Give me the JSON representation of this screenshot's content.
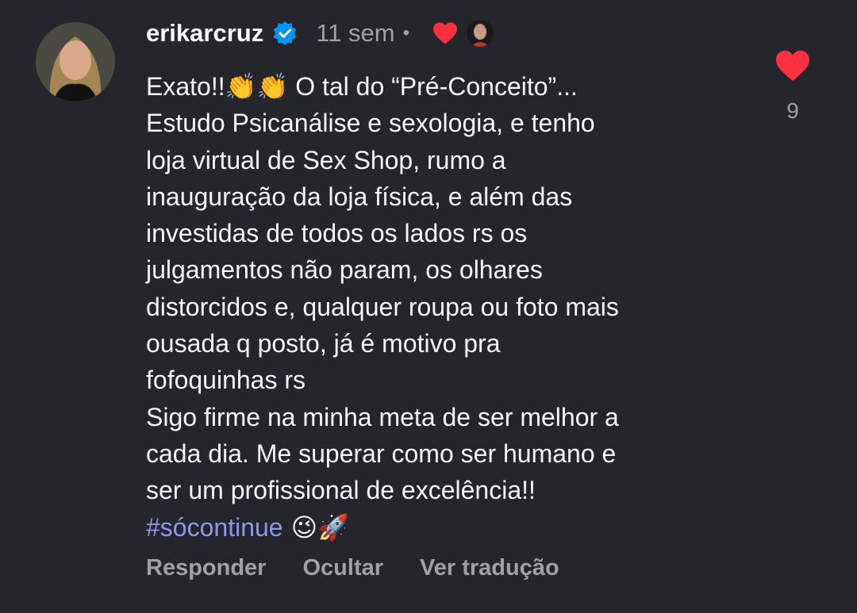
{
  "comment": {
    "username": "erikarcruz",
    "time": "11 sem",
    "dot": "•",
    "lines": [
      "Exato!!👏👏 O tal do “Pré-Conceito”...",
      "Estudo Psicanálise e sexologia, e tenho",
      "loja virtual de Sex Shop, rumo a",
      "inauguração da loja física, e além das",
      "investidas de todos os lados rs os",
      "julgamentos não param, os olhares",
      "distorcidos e, qualquer roupa ou foto mais",
      "ousada q posto, já é motivo pra",
      "fofoquinhas rs",
      "Sigo firme na minha meta de ser melhor a",
      "cada dia. Me superar como ser humano e",
      "ser um profissional de excelência!!"
    ],
    "hashtag": "#sócontinue",
    "trailing_emoji": " 😉🚀",
    "like_count": "9"
  },
  "actions": {
    "reply": "Responder",
    "hide": "Ocultar",
    "translate": "Ver tradução"
  },
  "icons": {
    "verified": "verified-badge-icon",
    "author_like": "heart-icon",
    "like": "heart-icon"
  },
  "colors": {
    "background": "#25262b",
    "heart": "#ff3040",
    "verified": "#0095f6",
    "hashtag": "#8e98f0",
    "muted": "#a0a0a5"
  }
}
